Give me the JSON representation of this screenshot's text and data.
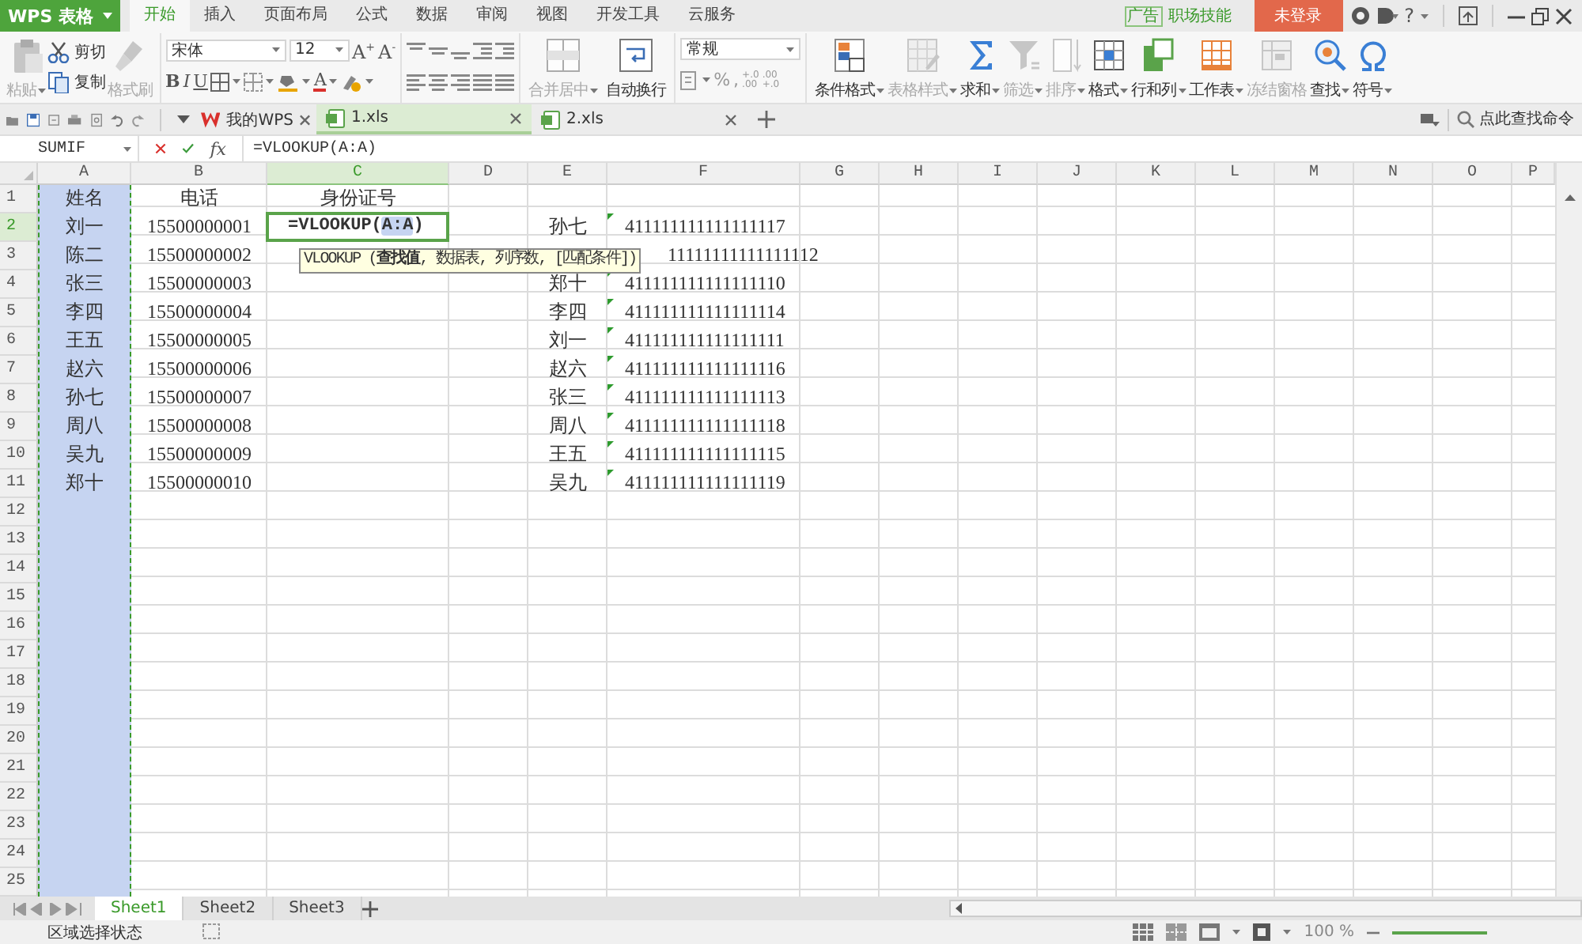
{
  "app_menu": {
    "label": "WPS 表格"
  },
  "menu_tabs": [
    {
      "label": "开始",
      "selected": true
    },
    {
      "label": "插入",
      "selected": false
    },
    {
      "label": "页面布局",
      "selected": false
    },
    {
      "label": "公式",
      "selected": false
    },
    {
      "label": "数据",
      "selected": false
    },
    {
      "label": "审阅",
      "selected": false
    },
    {
      "label": "视图",
      "selected": false
    },
    {
      "label": "开发工具",
      "selected": false
    },
    {
      "label": "云服务",
      "selected": false
    }
  ],
  "ad": {
    "tag": "广告",
    "label": "职场技能"
  },
  "login_button": "未登录",
  "help_label": "?",
  "ribbon": {
    "paste": {
      "label": "粘贴",
      "disabled": true
    },
    "cut": {
      "label": "剪切",
      "disabled": false
    },
    "copy": {
      "label": "复制",
      "disabled": false
    },
    "format_painter": {
      "label": "格式刷",
      "disabled": true
    },
    "font": "宋体",
    "font_size": "12",
    "size_buttons": [
      "A$^{+}$",
      "A$^{-}$"
    ],
    "style_buttons": [
      "B",
      "I",
      "U"
    ],
    "font_color": "A",
    "merge": {
      "label": "合并居中",
      "disabled": true
    },
    "wrap": {
      "label": "自动换行",
      "disabled": false
    },
    "number_format": "常规",
    "number_buttons": [
      "%",
      ","
    ],
    "decimal_buttons": [
      {
        "top": "+.0",
        "bottom": ".00"
      },
      {
        "top": ".00",
        "bottom": "+.0"
      }
    ],
    "big_buttons": [
      {
        "label": "条件格式",
        "disabled": false
      },
      {
        "label": "表格样式",
        "disabled": true
      },
      {
        "label": "求和",
        "disabled": false
      },
      {
        "label": "筛选",
        "disabled": true
      },
      {
        "label": "排序",
        "disabled": true
      },
      {
        "label": "格式",
        "disabled": false
      },
      {
        "label": "行和列",
        "disabled": false
      },
      {
        "label": "工作表",
        "disabled": false
      },
      {
        "label": "冻结窗格",
        "disabled": true
      },
      {
        "label": "查找",
        "disabled": false
      },
      {
        "label": "符号",
        "disabled": false
      }
    ]
  },
  "doc_tabs": [
    {
      "label": "我的WPS",
      "selected": false,
      "kind": "home"
    },
    {
      "label": "1.xls",
      "selected": true,
      "kind": "sheet"
    },
    {
      "label": "2.xls",
      "selected": false,
      "kind": "sheet"
    }
  ],
  "command_search": {
    "placeholder": "点此查找命令"
  },
  "formula_bar": {
    "name_box": "SUMIF",
    "fx": "fx",
    "formula": "=VLOOKUP(A:A)"
  },
  "sheet": {
    "columns": [
      {
        "label": "A",
        "active": false,
        "referenced": true
      },
      {
        "label": "B",
        "active": false,
        "referenced": false
      },
      {
        "label": "C",
        "active": true,
        "referenced": false
      },
      {
        "label": "D",
        "active": false,
        "referenced": false
      },
      {
        "label": "E",
        "active": false,
        "referenced": false
      },
      {
        "label": "F",
        "active": false,
        "referenced": false
      },
      {
        "label": "G",
        "active": false,
        "referenced": false
      },
      {
        "label": "H",
        "active": false,
        "referenced": false
      },
      {
        "label": "I",
        "active": false,
        "referenced": false
      },
      {
        "label": "J",
        "active": false,
        "referenced": false
      },
      {
        "label": "K",
        "active": false,
        "referenced": false
      },
      {
        "label": "L",
        "active": false,
        "referenced": false
      },
      {
        "label": "M",
        "active": false,
        "referenced": false
      },
      {
        "label": "N",
        "active": false,
        "referenced": false
      },
      {
        "label": "O",
        "active": false,
        "referenced": false
      },
      {
        "label": "P",
        "active": false,
        "referenced": false
      }
    ],
    "rows": [
      {
        "label": "1",
        "active": false,
        "A": "姓名",
        "B": "电话",
        "C": "身份证号"
      },
      {
        "label": "2",
        "active": true,
        "A": "刘一",
        "B": "15500000001",
        "E": "孙七",
        "F": "411111111111111117",
        "f_marker": true
      },
      {
        "label": "3",
        "active": false,
        "A": "陈二",
        "B": "15500000002",
        "F": "11111111111111112",
        "f_marker": false
      },
      {
        "label": "4",
        "active": false,
        "A": "张三",
        "B": "15500000003",
        "E": "郑十",
        "F": "411111111111111110",
        "f_marker": true
      },
      {
        "label": "5",
        "active": false,
        "A": "李四",
        "B": "15500000004",
        "E": "李四",
        "F": "411111111111111114",
        "f_marker": true
      },
      {
        "label": "6",
        "active": false,
        "A": "王五",
        "B": "15500000005",
        "E": "刘一",
        "F": "411111111111111111",
        "f_marker": true
      },
      {
        "label": "7",
        "active": false,
        "A": "赵六",
        "B": "15500000006",
        "E": "赵六",
        "F": "411111111111111116",
        "f_marker": true
      },
      {
        "label": "8",
        "active": false,
        "A": "孙七",
        "B": "15500000007",
        "E": "张三",
        "F": "411111111111111113",
        "f_marker": true
      },
      {
        "label": "9",
        "active": false,
        "A": "周八",
        "B": "15500000008",
        "E": "周八",
        "F": "411111111111111118",
        "f_marker": true
      },
      {
        "label": "10",
        "active": false,
        "A": "吴九",
        "B": "15500000009",
        "E": "王五",
        "F": "411111111111111115",
        "f_marker": true
      },
      {
        "label": "11",
        "active": false,
        "A": "郑十",
        "B": "15500000010",
        "E": "吴九",
        "F": "411111111111111119",
        "f_marker": true
      },
      {
        "label": "12",
        "active": false
      },
      {
        "label": "13",
        "active": false
      },
      {
        "label": "14",
        "active": false
      },
      {
        "label": "15",
        "active": false
      },
      {
        "label": "16",
        "active": false
      },
      {
        "label": "17",
        "active": false
      },
      {
        "label": "18",
        "active": false
      },
      {
        "label": "19",
        "active": false
      },
      {
        "label": "20",
        "active": false
      },
      {
        "label": "21",
        "active": false
      },
      {
        "label": "22",
        "active": false
      },
      {
        "label": "23",
        "active": false
      },
      {
        "label": "24",
        "active": false
      },
      {
        "label": "25",
        "active": false
      }
    ],
    "editor": {
      "text_before": "=VLOOKUP(",
      "reference": "A:A",
      "text_after": ")"
    },
    "tooltip": "VLOOKUP (**查找值**, 数据表, 列序数, [匹配条件])"
  },
  "sheet_tabs": [
    {
      "label": "Sheet1",
      "selected": true
    },
    {
      "label": "Sheet2",
      "selected": false
    },
    {
      "label": "Sheet3",
      "selected": false
    }
  ],
  "status_bar": {
    "mode": "区域选择状态",
    "zoom": "100 %"
  }
}
